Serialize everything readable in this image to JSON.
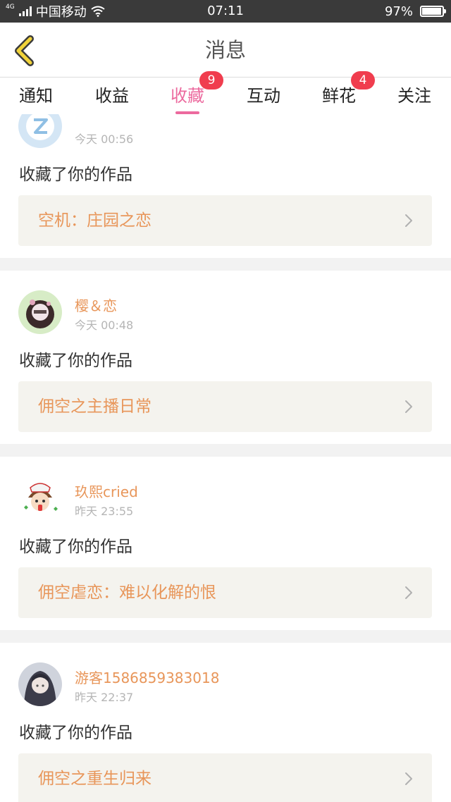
{
  "status_bar": {
    "network_type": "4G",
    "carrier": "中国移动",
    "time": "07:11",
    "battery": "97%",
    "battery_level": 0.97
  },
  "header": {
    "title": "消息",
    "back_icon": "chevron-left-icon"
  },
  "tabs": [
    {
      "label": "通知",
      "badge": null,
      "active": false
    },
    {
      "label": "收益",
      "badge": null,
      "active": false
    },
    {
      "label": "收藏",
      "badge": "9",
      "active": true
    },
    {
      "label": "互动",
      "badge": null,
      "active": false
    },
    {
      "label": "鲜花",
      "badge": "4",
      "active": false
    },
    {
      "label": "关注",
      "badge": null,
      "active": false
    }
  ],
  "feed": [
    {
      "username": "",
      "time": "今天 00:56",
      "action": "收藏了你的作品",
      "work_title": "空机：庄园之恋",
      "avatar": "default-avatar-icon"
    },
    {
      "username": "樱＆恋",
      "time": "今天 00:48",
      "action": "收藏了你的作品",
      "work_title": "佣空之主播日常",
      "avatar": "user-avatar"
    },
    {
      "username": "玖熙cried",
      "time": "昨天 23:55",
      "action": "收藏了你的作品",
      "work_title": "佣空虐恋：难以化解的恨",
      "avatar": "user-avatar"
    },
    {
      "username": "游客1586859383018",
      "time": "昨天 22:37",
      "action": "收藏了你的作品",
      "work_title": "佣空之重生归来",
      "avatar": "user-avatar"
    }
  ],
  "colors": {
    "accent_pink": "#ec6a9e",
    "orange_text": "#e8965a",
    "badge_red": "#f03d4e",
    "back_arrow_yellow": "#f1d33a"
  }
}
